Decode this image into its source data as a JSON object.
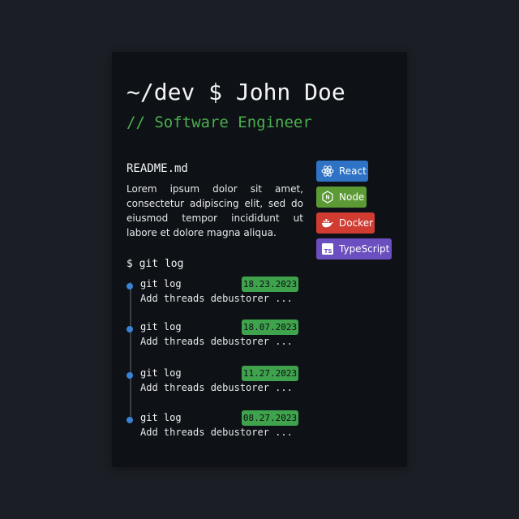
{
  "header": {
    "title": "~/dev $ John Doe",
    "subtitle": "// Software Engineer"
  },
  "readme": {
    "title": "README.md",
    "body": "Lorem ipsum dolor sit amet, consectetur adipiscing elit, sed do eiusmod tempor incididunt ut labore et dolore magna aliqua."
  },
  "tags": [
    {
      "label": "React",
      "icon": "react-icon",
      "color": "#2e73c5"
    },
    {
      "label": "Node",
      "icon": "node-icon",
      "color": "#5c9a35"
    },
    {
      "label": "Docker",
      "icon": "docker-icon",
      "color": "#d03c32"
    },
    {
      "label": "TypeScript",
      "icon": "typescript-icon",
      "color": "#6b4fc0"
    }
  ],
  "gitlog": {
    "title": "$ git log",
    "commits": [
      {
        "label": "git log",
        "date": "18.23.2023",
        "message": "Add threads debustorer ..."
      },
      {
        "label": "git log",
        "date": "18.07.2023",
        "message": "Add threads debustorer ..."
      },
      {
        "label": "git log",
        "date": "11.27.2023",
        "message": "Add threads debustorer ..."
      },
      {
        "label": "git log",
        "date": "08.27.2023",
        "message": "Add threads debustorer ..."
      }
    ]
  },
  "colors": {
    "background": "#1b1e24",
    "card": "#0e1115",
    "accent_green": "#4caf50",
    "timeline_dot": "#3b82d6"
  }
}
